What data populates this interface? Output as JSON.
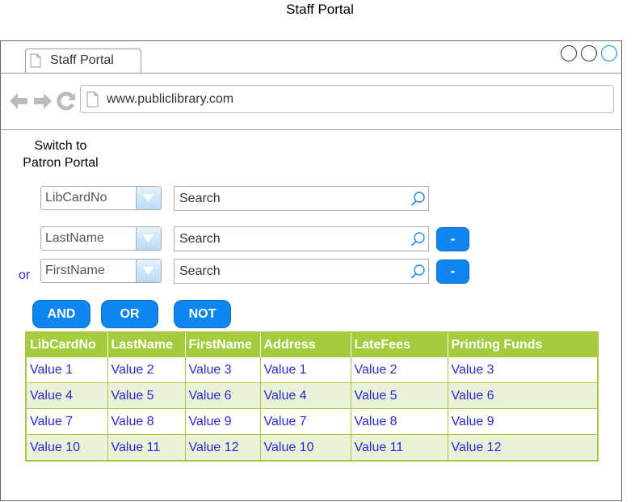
{
  "caption": "Staff Portal",
  "browser": {
    "tab_title": "Staff Portal",
    "url": "www.publiclibrary.com"
  },
  "switch_link": {
    "line1": "Switch to",
    "line2": "Patron Portal"
  },
  "filters": [
    {
      "field": "LibCardNo",
      "placeholder": "Search"
    },
    {
      "field": "LastName",
      "placeholder": "Search",
      "remove_label": "-"
    },
    {
      "field": "FirstName",
      "placeholder": "Search",
      "remove_label": "-"
    }
  ],
  "or_label": "or",
  "logic_buttons": {
    "and": "AND",
    "or": "OR",
    "not": "NOT"
  },
  "table": {
    "headers": [
      "LibCardNo",
      "LastName",
      "FirstName",
      "Address",
      "LateFees",
      "Printing Funds"
    ],
    "rows": [
      [
        "Value 1",
        "Value 2",
        "Value 3",
        "Value 1",
        "Value 2",
        "Value 3"
      ],
      [
        "Value 4",
        "Value 5",
        "Value 6",
        "Value 4",
        "Value 5",
        "Value 6"
      ],
      [
        "Value 7",
        "Value 8",
        "Value 9",
        "Value 7",
        "Value 8",
        "Value 9"
      ],
      [
        "Value 10",
        "Value 11",
        "Value 12",
        "Value 10",
        "Value 11",
        "Value 12"
      ]
    ]
  },
  "colors": {
    "accent": "#0f85f0",
    "table_header": "#a5cc3f",
    "link_text": "#2a2ad0",
    "alt_row": "#e9f1d8"
  }
}
